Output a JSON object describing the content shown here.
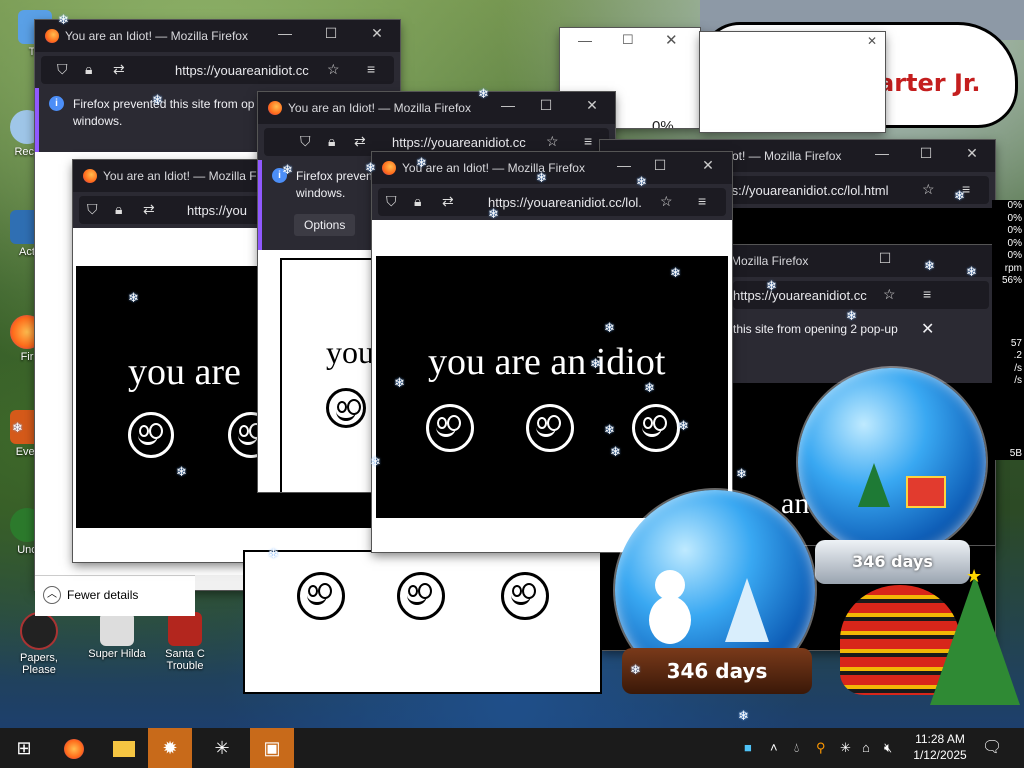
{
  "desktop": {
    "icons": [
      {
        "label": "Th",
        "name": "desktop-icon-th"
      },
      {
        "label": "Recy",
        "name": "desktop-icon-recycle"
      },
      {
        "label": "Act",
        "name": "desktop-icon-act"
      },
      {
        "label": "Fir",
        "name": "desktop-icon-firefox"
      },
      {
        "label": "Ever",
        "name": "desktop-icon-ever"
      },
      {
        "label": "Unc",
        "name": "desktop-icon-unc"
      },
      {
        "label": "Papers, Please",
        "name": "desktop-icon-papers-please"
      },
      {
        "label": "Super Hilda",
        "name": "desktop-icon-super-hilda"
      },
      {
        "label": "Santa C Trouble",
        "name": "desktop-icon-santa"
      }
    ],
    "banner_text": "arter Jr.",
    "progress_percent": "0%",
    "fewer_details": "Fewer details"
  },
  "windows": {
    "title": "You are an Idiot! — Mozilla Firefox",
    "title_short": "You are an Idiot! — Mozilla Firefox",
    "title_tail": "idiot! — Mozilla Firefox",
    "title_tail2": "Mozilla Firefox",
    "url_a": "https://youareanidiot.cc",
    "url_b": "https://you",
    "url_c": "https://youareanidiot.cc/lol.",
    "url_d": "https://youareanidiot.cc/lol.html",
    "notif_line1": "Firefox prevented this site from op",
    "notif_line2": "windows.",
    "notif_short1": "Firefox preven",
    "notif_tail": "this site from opening 2 pop-up",
    "options": "Options",
    "message_full": "you are an idiot",
    "message_part": "you are",
    "message_short": "you",
    "message_an": "an"
  },
  "globes": {
    "left_days": "346 days",
    "right_days": "346 days"
  },
  "stats": [
    "0%",
    "0%",
    "0%",
    "0%",
    "0%",
    "rpm",
    "56%",
    "",
    "",
    "57",
    ".2",
    "/s",
    "/s",
    "",
    "",
    "",
    "",
    "",
    "",
    "",
    "5B"
  ],
  "taskbar": {
    "time": "11:28 AM",
    "date": "1/12/2025"
  }
}
